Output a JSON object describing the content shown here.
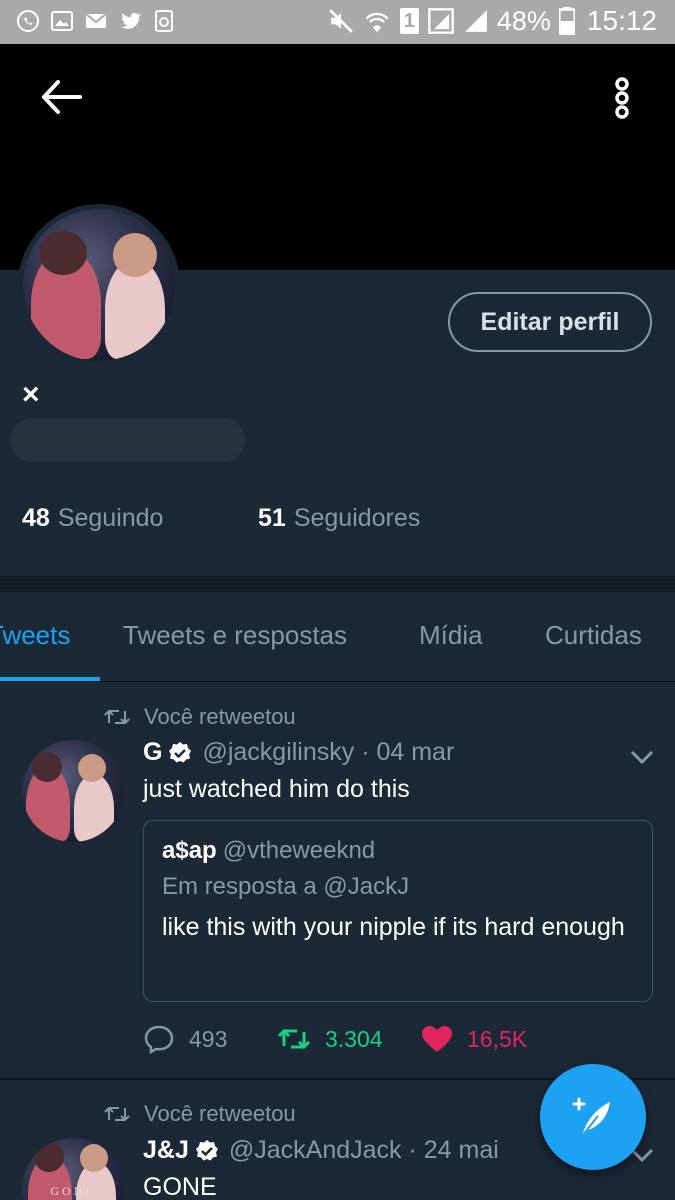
{
  "status_bar": {
    "battery": "48%",
    "time": "15:12",
    "sim_slot": "1",
    "icons": [
      "whatsapp-icon",
      "gallery-icon",
      "mail-icon",
      "twitter-icon",
      "recycle-icon",
      "mute-icon",
      "wifi-icon",
      "signal-icon",
      "battery-icon"
    ]
  },
  "profile": {
    "name_mark": "×",
    "edit_button": "Editar perfil",
    "following_count": "48",
    "following_label": "Seguindo",
    "followers_count": "51",
    "followers_label": "Seguidores"
  },
  "tabs": [
    {
      "label": "Tweets",
      "active": true
    },
    {
      "label": "Tweets e respostas",
      "active": false
    },
    {
      "label": "Mídia",
      "active": false
    },
    {
      "label": "Curtidas",
      "active": false
    }
  ],
  "tweets": [
    {
      "retweet_label": "Você retweetou",
      "name": "G",
      "handle": "@jackgilinsky · 04 mar",
      "text": "just watched him do this",
      "quote": {
        "name": "a$ap",
        "handle": "@vtheweeknd",
        "reply_to": "Em resposta a @JackJ",
        "text": "like this with your nipple if its hard enough"
      },
      "replies": "493",
      "retweets": "3.304",
      "likes": "16,5K"
    },
    {
      "retweet_label": "Você retweetou",
      "name": "J&J",
      "handle": "@JackAndJack · 24 mai",
      "text": "GONE",
      "avatar_text": "GONE"
    }
  ],
  "colors": {
    "background": "#1b2836",
    "accent": "#1da1f2",
    "retweet_green": "#19cf86",
    "like_red": "#e0245e",
    "muted": "#8899a6"
  }
}
